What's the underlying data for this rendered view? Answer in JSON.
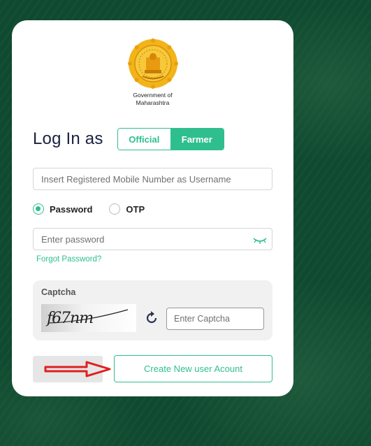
{
  "header": {
    "emblem_icon": "maharashtra-emblem-icon",
    "gov_line1": "Government of",
    "gov_line2": "Maharashtra"
  },
  "login": {
    "title": "Log In as",
    "toggle_official": "Official",
    "toggle_farmer": "Farmer",
    "selected_role": "Farmer"
  },
  "username": {
    "placeholder": "Insert Registered Mobile Number as Username"
  },
  "auth_method": {
    "options": [
      "Password",
      "OTP"
    ],
    "selected": "Password"
  },
  "password": {
    "placeholder": "Enter password",
    "toggle_icon": "eye-closed-icon"
  },
  "forgot_label": "Forgot Password?",
  "captcha": {
    "label": "Captcha",
    "code": "f67nm",
    "refresh_icon": "refresh-icon",
    "input_placeholder": "Enter Captcha"
  },
  "create_account_label": "Create New user Acount",
  "colors": {
    "accent": "#2fbf8e",
    "background": "#0f4a30",
    "arrow": "#e02020"
  }
}
